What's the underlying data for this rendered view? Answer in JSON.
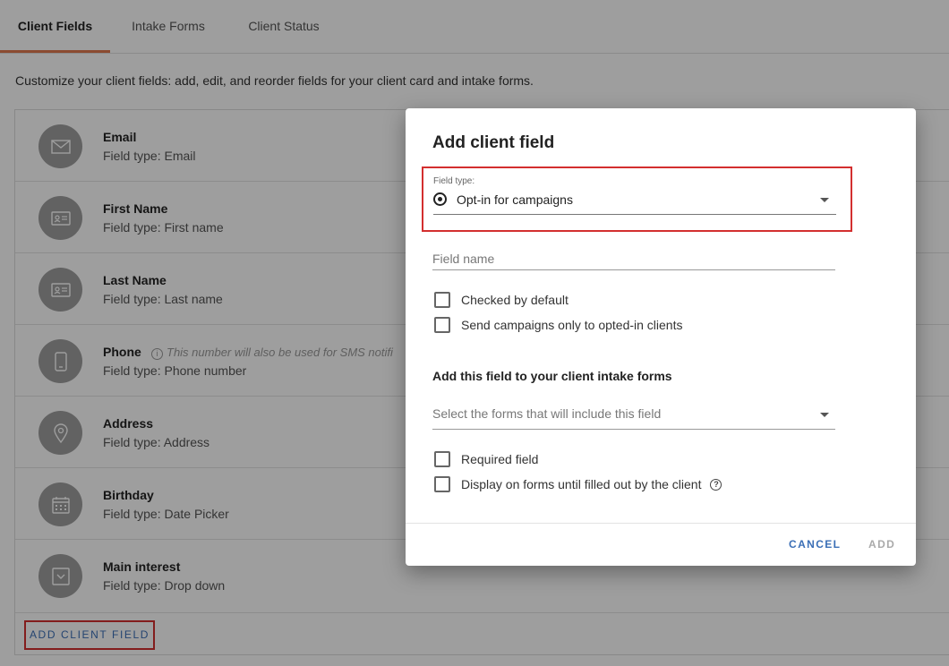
{
  "tabs": [
    {
      "label": "Client Fields",
      "active": true
    },
    {
      "label": "Intake Forms",
      "active": false
    },
    {
      "label": "Client Status",
      "active": false
    }
  ],
  "description": "Customize your client fields: add, edit, and reorder fields for your client card and intake forms.",
  "fields": [
    {
      "name": "Email",
      "type": "Field type: Email",
      "icon": "envelope-icon"
    },
    {
      "name": "First Name",
      "type": "Field type: First name",
      "icon": "id-card-icon"
    },
    {
      "name": "Last Name",
      "type": "Field type: Last name",
      "icon": "id-card-icon"
    },
    {
      "name": "Phone",
      "type": "Field type: Phone number",
      "icon": "phone-icon",
      "note": "This number will also be used for SMS notifi"
    },
    {
      "name": "Address",
      "type": "Field type: Address",
      "icon": "location-pin-icon"
    },
    {
      "name": "Birthday",
      "type": "Field type: Date Picker",
      "icon": "calendar-icon"
    },
    {
      "name": "Main interest",
      "type": "Field type: Drop down",
      "icon": "dropdown-icon"
    }
  ],
  "add_field_label": "ADD CLIENT FIELD",
  "dialog": {
    "title": "Add client field",
    "field_type_label": "Field type:",
    "field_type_value": "Opt-in for campaigns",
    "field_name_placeholder": "Field name",
    "checkbox_checked_default": "Checked by default",
    "checkbox_send_campaigns": "Send campaigns only to opted-in clients",
    "section_title": "Add this field to your client intake forms",
    "forms_placeholder": "Select the forms that will include this field",
    "checkbox_required": "Required field",
    "checkbox_display_forms": "Display on forms until filled out by the client",
    "cancel_label": "CANCEL",
    "add_label": "ADD"
  },
  "colors": {
    "accent_tab": "#e07a4f",
    "link_blue": "#3b6fb6",
    "highlight_red": "#d32f2f"
  }
}
